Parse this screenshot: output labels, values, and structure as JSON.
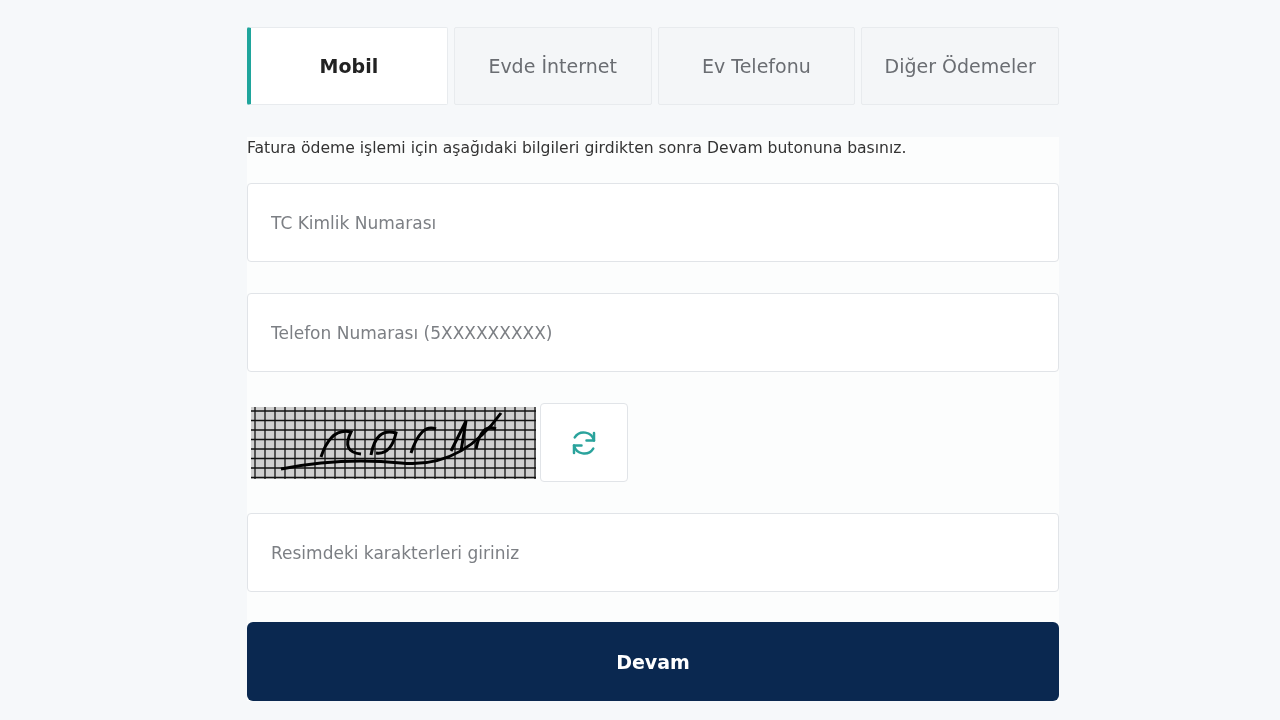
{
  "tabs": [
    {
      "label": "Mobil",
      "selected": true
    },
    {
      "label": "Evde İnternet",
      "selected": false
    },
    {
      "label": "Ev Telefonu",
      "selected": false
    },
    {
      "label": "Diğer Ödemeler",
      "selected": false
    }
  ],
  "instruction": "Fatura ödeme işlemi için aşağıdaki bilgileri girdikten sonra Devam butonuna basınız.",
  "form_items": [
    {
      "kind": "field",
      "placeholder": "TC Kimlik Numarası"
    },
    {
      "kind": "field",
      "placeholder": "Telefon Numarası (5XXXXXXXXX)"
    },
    {
      "kind": "captcha"
    },
    {
      "kind": "field",
      "placeholder": "Resimdeki karakterleri giriniz"
    }
  ],
  "submit_button": "Devam"
}
